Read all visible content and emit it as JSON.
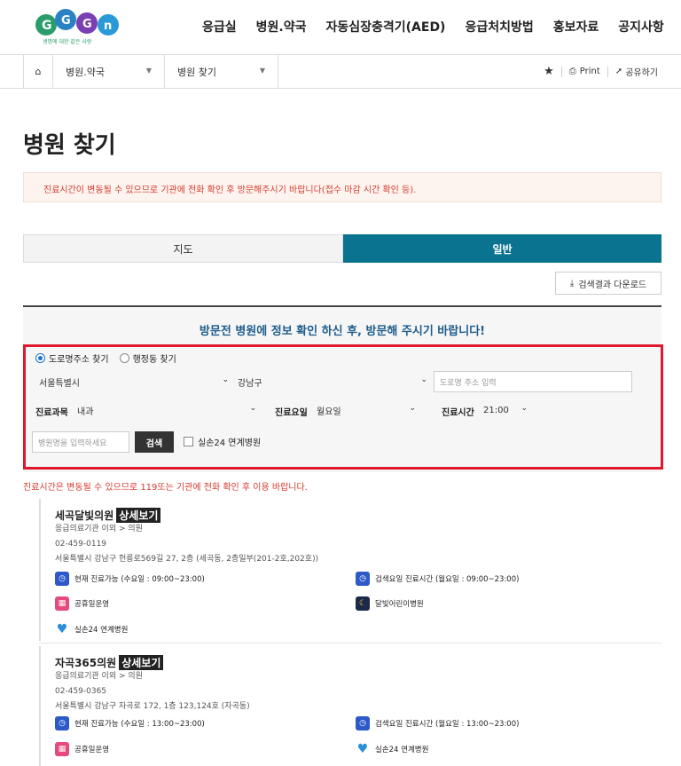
{
  "logo": {
    "subtext": "생명에 대한 같은 사랑"
  },
  "nav": [
    "응급실",
    "병원.약국",
    "자동심장충격기(AED)",
    "응급처치방법",
    "홍보자료",
    "공지사항"
  ],
  "breadcrumb": {
    "level1": "병원.약국",
    "level2": "병원 찾기",
    "print": "Print",
    "share": "공유하기"
  },
  "page_title": "병원 찾기",
  "notice": "진료시간이 변동될 수 있으므로 기관에 전화 확인 후 방문해주시기 바랍니다(접수 마감 시간 확인 등).",
  "tabs": {
    "map": "지도",
    "general": "일반"
  },
  "download_button": "검색결과 다운로드",
  "search": {
    "heading": "방문전 병원에 정보 확인 하신 후, 방문해 주시기 바랍니다!",
    "radio_road": "도로명주소 찾기",
    "radio_admin": "행정동 찾기",
    "sido": "서울특별시",
    "sigungu": "강남구",
    "road_placeholder": "도로명 주소 입력",
    "dept_label": "진료과목",
    "dept_value": "내과",
    "day_label": "진료요일",
    "day_value": "월요일",
    "time_label": "진료시간",
    "time_value": "21:00",
    "name_placeholder": "병원명을 입력하세요",
    "search_button": "검색",
    "checkbox_label": "실손24 연계병원"
  },
  "warning": "진료시간은 변동될 수 있으므로 119또는 기관에 전화 확인 후 이용 바랍니다.",
  "results": [
    {
      "name": "세곡달빛의원",
      "detail": "상세보기",
      "category": "응급의료기관 이외 > 의원",
      "phone": "02-459-0119",
      "address": "서울특별시 강남구 헌릉로569길 27, 2층 (세곡동, 2층일부(201-2호,202호))",
      "now_open": "현재 진료가능 (수요일 : 09:00~23:00)",
      "search_hours": "검색요일 진료시간 (월요일 : 09:00~23:00)",
      "holiday": "공휴일운영",
      "night": "달빛어린이병원",
      "linked": "실손24 연계병원"
    },
    {
      "name": "자곡365의원",
      "detail": "상세보기",
      "category": "응급의료기관 이외 > 의원",
      "phone": "02-459-0365",
      "address": "서울특별시 강남구 자곡로 172, 1층 123,124호 (자곡동)",
      "now_open": "현재 진료가능 (수요일 : 13:00~23:00)",
      "search_hours": "검색요일 진료시간 (월요일 : 13:00~23:00)",
      "holiday": "공휴일운영",
      "linked": "실손24 연계병원"
    }
  ]
}
